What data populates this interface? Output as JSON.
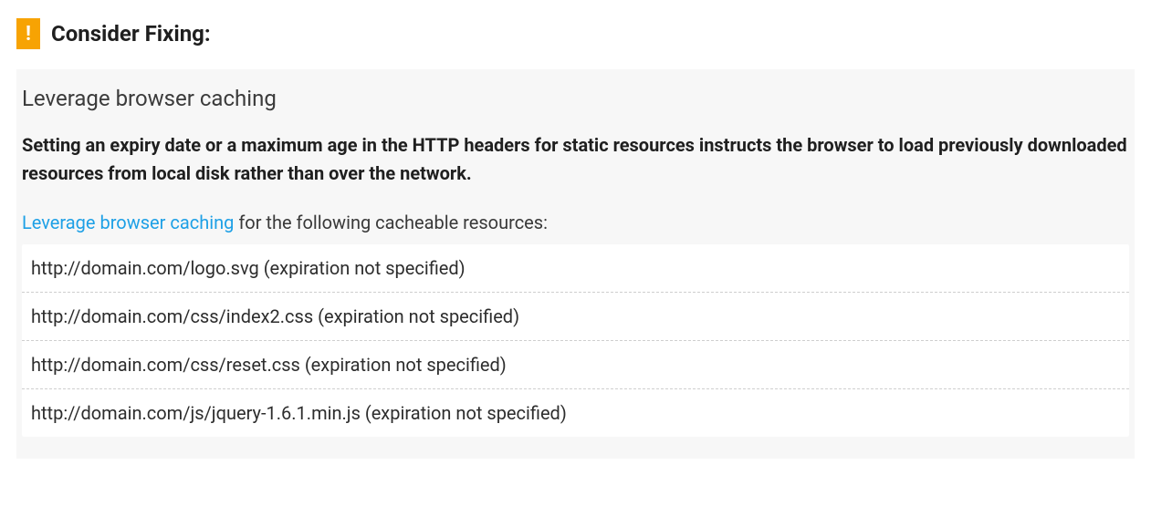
{
  "header": {
    "badge_char": "!",
    "title": "Consider Fixing:"
  },
  "rule": {
    "title": "Leverage browser caching",
    "description": "Setting an expiry date or a maximum age in the HTTP headers for static resources instructs the browser to load previously downloaded resources from local disk rather than over the network.",
    "hint_link_text": "Leverage browser caching",
    "hint_after": " for the following cacheable resources:"
  },
  "resources": [
    "http://domain.com/logo.svg (expiration not specified)",
    "http://domain.com/css/index2.css (expiration not specified)",
    "http://domain.com/css/reset.css (expiration not specified)",
    "http://domain.com/js/jquery-1.6.1.min.js (expiration not specified)"
  ]
}
